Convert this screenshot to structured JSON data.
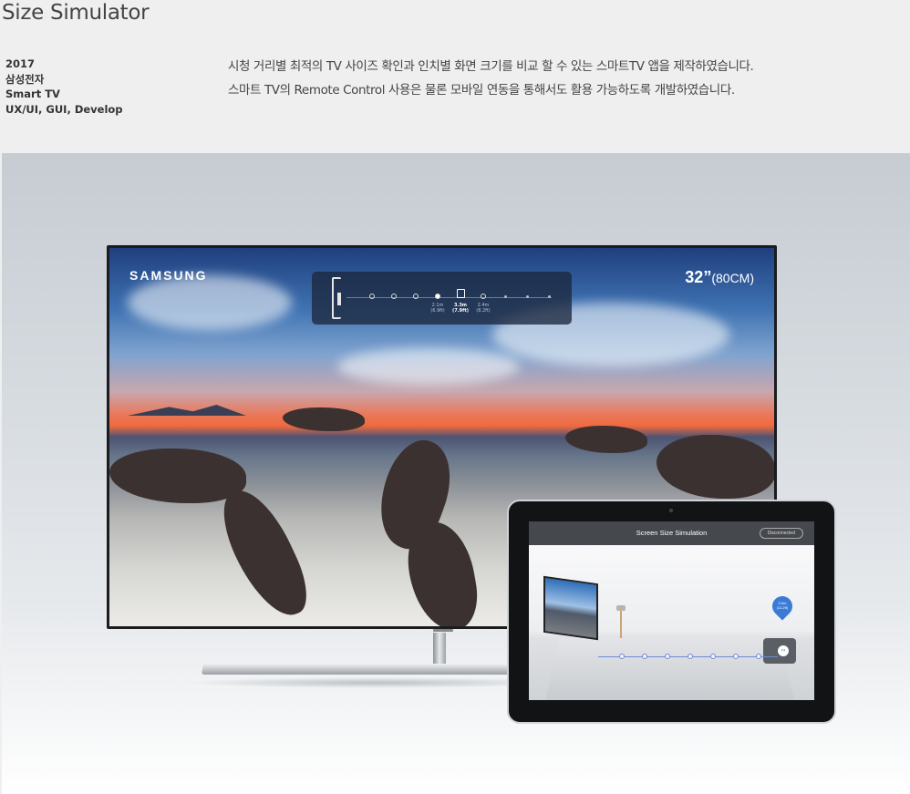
{
  "page": {
    "title": "Size Simulator"
  },
  "project": {
    "year": "2017",
    "client": "삼성전자",
    "platform": "Smart TV",
    "roles": "UX/UI, GUI, Develop"
  },
  "description": {
    "line1": "시청 거리별 최적의 TV 사이즈 확인과 인치별 화면 크기를 비교 할 수 있는 스마트TV 앱을 제작하였습니다.",
    "line2": "스마트 TV의 Remote Control 사용은 물론 모바일 연동을 통해서도 활용 가능하도록 개발하였습니다."
  },
  "tv": {
    "brand": "SAMSUNG",
    "size_inch": "32”",
    "size_cm": "(80CM)",
    "distances": [
      {
        "label": "2.1m",
        "sub": "(6.9ft)"
      },
      {
        "label": "3.3m",
        "sub": "(7.9ft)"
      },
      {
        "label": "2.4m",
        "sub": "(8.2ft)"
      }
    ]
  },
  "tablet_app": {
    "title": "Screen Size Simulation",
    "status": "Disconnected",
    "pin_label": "3.0m (11.2ft)"
  },
  "colors": {
    "tv_panel": "#1c283e",
    "accent_blue": "#3a7bd5",
    "app_header": "#45484d"
  }
}
